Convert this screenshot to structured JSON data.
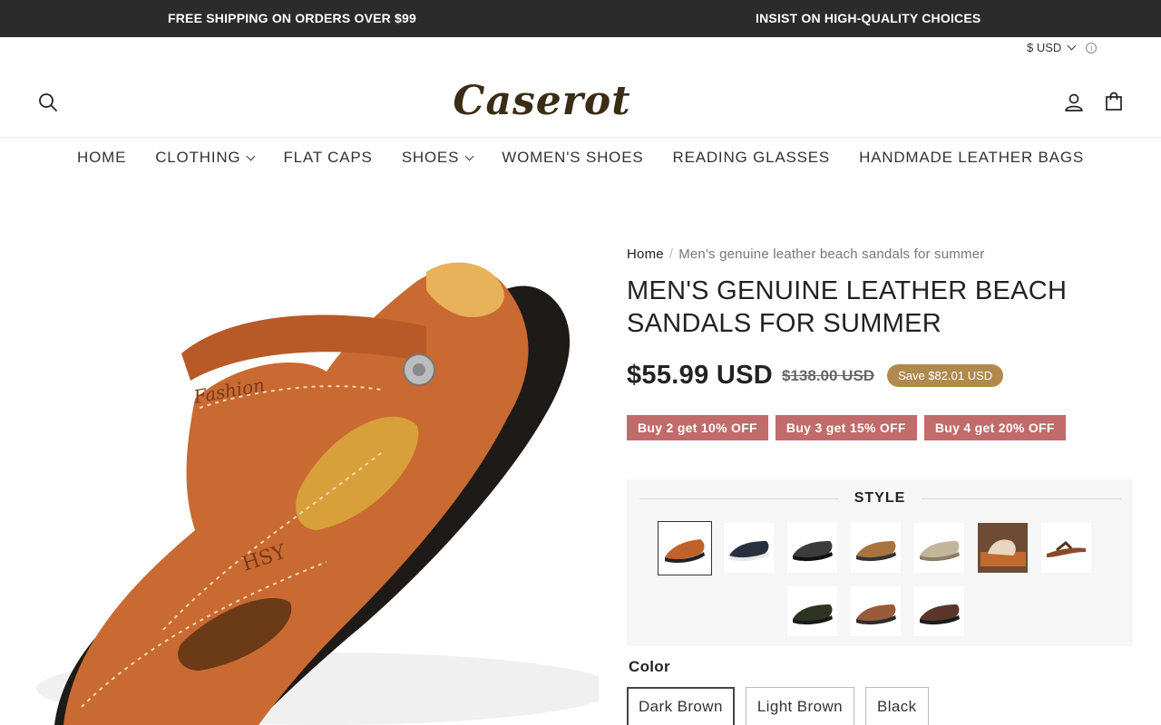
{
  "announcement": {
    "left": "FREE SHIPPING ON ORDERS OVER $99",
    "right": "INSIST ON HIGH-QUALITY CHOICES"
  },
  "currency": {
    "label": "$ USD"
  },
  "logo": {
    "text": "Caserot"
  },
  "nav": {
    "items": [
      {
        "label": "HOME",
        "dropdown": false
      },
      {
        "label": "CLOTHING",
        "dropdown": true
      },
      {
        "label": "FLAT CAPS",
        "dropdown": false
      },
      {
        "label": "SHOES",
        "dropdown": true
      },
      {
        "label": "WOMEN'S SHOES",
        "dropdown": false
      },
      {
        "label": "READING GLASSES",
        "dropdown": false
      },
      {
        "label": "HANDMADE LEATHER BAGS",
        "dropdown": false
      }
    ]
  },
  "breadcrumb": {
    "home": "Home",
    "separator": "/",
    "current": "Men's genuine leather beach sandals for summer"
  },
  "product": {
    "title": "MEN'S GENUINE LEATHER BEACH SANDALS FOR SUMMER",
    "price": "$55.99 USD",
    "compare_price": "$138.00 USD",
    "save_badge": "Save $82.01 USD",
    "offers": [
      "Buy 2 get 10% OFF",
      "Buy 3 get 15% OFF",
      "Buy 4 get 20% OFF"
    ]
  },
  "style": {
    "heading": "STYLE",
    "thumbnails": [
      {
        "color": "#c0622a",
        "selected": true
      },
      {
        "color": "#26303f",
        "selected": false
      },
      {
        "color": "#3c3c3c",
        "selected": false
      },
      {
        "color": "#a9743f",
        "selected": false
      },
      {
        "color": "#c2b59a",
        "selected": false
      },
      {
        "color": "#6e4b34",
        "selected": false
      },
      {
        "color": "#8a4a2a",
        "selected": false
      },
      {
        "color": "#2f3324",
        "selected": false
      },
      {
        "color": "#9a5a3c",
        "selected": false
      },
      {
        "color": "#5a3628",
        "selected": false
      }
    ]
  },
  "color": {
    "label": "Color",
    "options": [
      {
        "label": "Dark Brown",
        "selected": true
      },
      {
        "label": "Light Brown",
        "selected": false
      },
      {
        "label": "Black",
        "selected": false
      }
    ]
  },
  "colors": {
    "announcement_bg": "#2b2b2b",
    "offer_bg": "#c26b6b",
    "save_badge_bg": "#b08a4d",
    "sandal_leather": "#c96a33",
    "sandal_sole": "#1e1a18"
  }
}
